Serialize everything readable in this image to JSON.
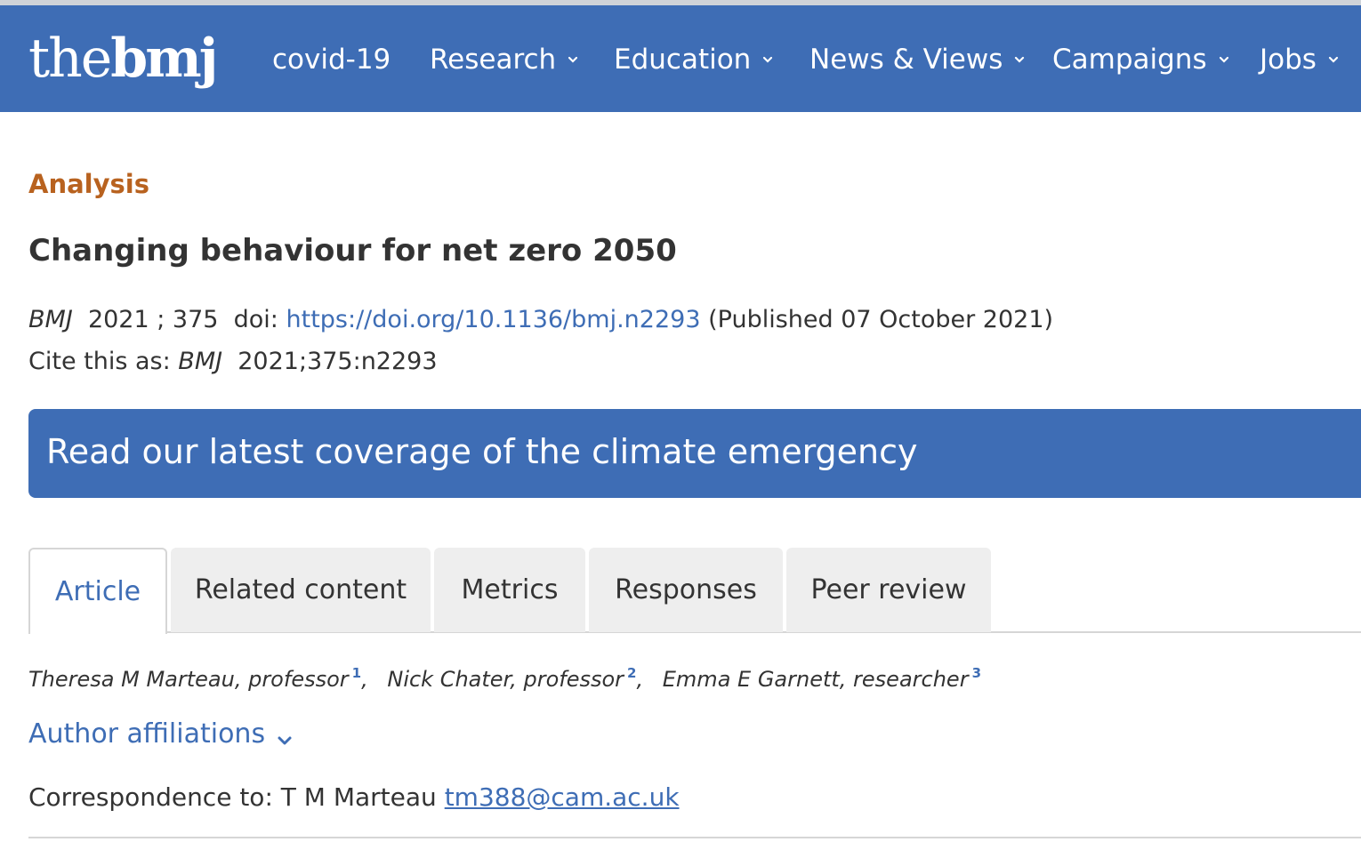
{
  "colors": {
    "brand_blue": "#3e6db5",
    "kicker_orange": "#b8621f",
    "tab_inactive_bg": "#eeeeee",
    "text": "#333333"
  },
  "logo": {
    "thin": "the",
    "bold": "bmj"
  },
  "nav": {
    "items": [
      {
        "label": "covid-19",
        "icon": null
      },
      {
        "label": "Research",
        "icon": "chevron-down-icon"
      },
      {
        "label": "Education",
        "icon": "chevron-down-icon"
      },
      {
        "label": "News & Views",
        "icon": "chevron-down-icon"
      },
      {
        "label": "Campaigns",
        "icon": "chevron-down-icon"
      },
      {
        "label": "Jobs",
        "icon": "chevron-down-icon"
      }
    ]
  },
  "article": {
    "kicker": "Analysis",
    "title": "Changing behaviour for net zero 2050",
    "citation": {
      "journal": "BMJ",
      "year_vol": "2021 ; 375",
      "doi_prefix": "doi:",
      "doi_link": "https://doi.org/10.1136/bmj.n2293",
      "published": "(Published 07 October 2021)"
    },
    "cite_as": {
      "prefix": "Cite this as:",
      "journal": "BMJ",
      "ref": "2021;375:n2293"
    }
  },
  "banner": {
    "text": "Read our latest coverage of the climate emergency"
  },
  "tabs": [
    {
      "label": "Article",
      "active": true
    },
    {
      "label": "Related content",
      "active": false
    },
    {
      "label": "Metrics",
      "active": false
    },
    {
      "label": "Responses",
      "active": false
    },
    {
      "label": "Peer review",
      "active": false
    }
  ],
  "authors": [
    {
      "name": "Theresa M Marteau, professor",
      "sup": "1",
      "sep": ","
    },
    {
      "name": "Nick Chater, professor",
      "sup": "2",
      "sep": ","
    },
    {
      "name": "Emma E Garnett, researcher",
      "sup": "3",
      "sep": ""
    }
  ],
  "affiliations": {
    "label": "Author affiliations",
    "icon": "chevron-down-icon"
  },
  "correspondence": {
    "prefix": "Correspondence to: T M Marteau",
    "email": "tm388@cam.ac.uk"
  }
}
